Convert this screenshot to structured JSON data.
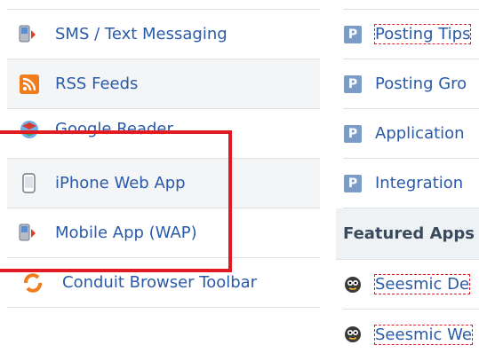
{
  "left_list": {
    "items": [
      {
        "label": "SMS / Text Messaging",
        "icon": "sms-phone-icon"
      },
      {
        "label": "RSS Feeds",
        "icon": "rss-icon"
      },
      {
        "label": "Google Reader",
        "icon": "google-reader-icon"
      },
      {
        "label": "iPhone Web App",
        "icon": "iphone-icon"
      },
      {
        "label": "Mobile App (WAP)",
        "icon": "mobile-phone-icon"
      },
      {
        "label": "Conduit Browser Toolbar",
        "icon": "conduit-icon"
      }
    ]
  },
  "right_list": {
    "items": [
      {
        "label": "Posting Tips",
        "badge": "P"
      },
      {
        "label": "Posting Gro",
        "badge": "P"
      },
      {
        "label": "Application",
        "badge": "P"
      },
      {
        "label": "Integration",
        "badge": "P"
      }
    ],
    "featured_header": "Featured Apps",
    "apps": [
      {
        "label": "Seesmic De",
        "icon": "seesmic-icon"
      },
      {
        "label": "Seesmic We",
        "icon": "seesmic-icon"
      }
    ]
  },
  "colors": {
    "link": "#2a5aa8",
    "highlight": "#e21a22",
    "badge": "#7a9cc6",
    "rss": "#f07c1c"
  }
}
